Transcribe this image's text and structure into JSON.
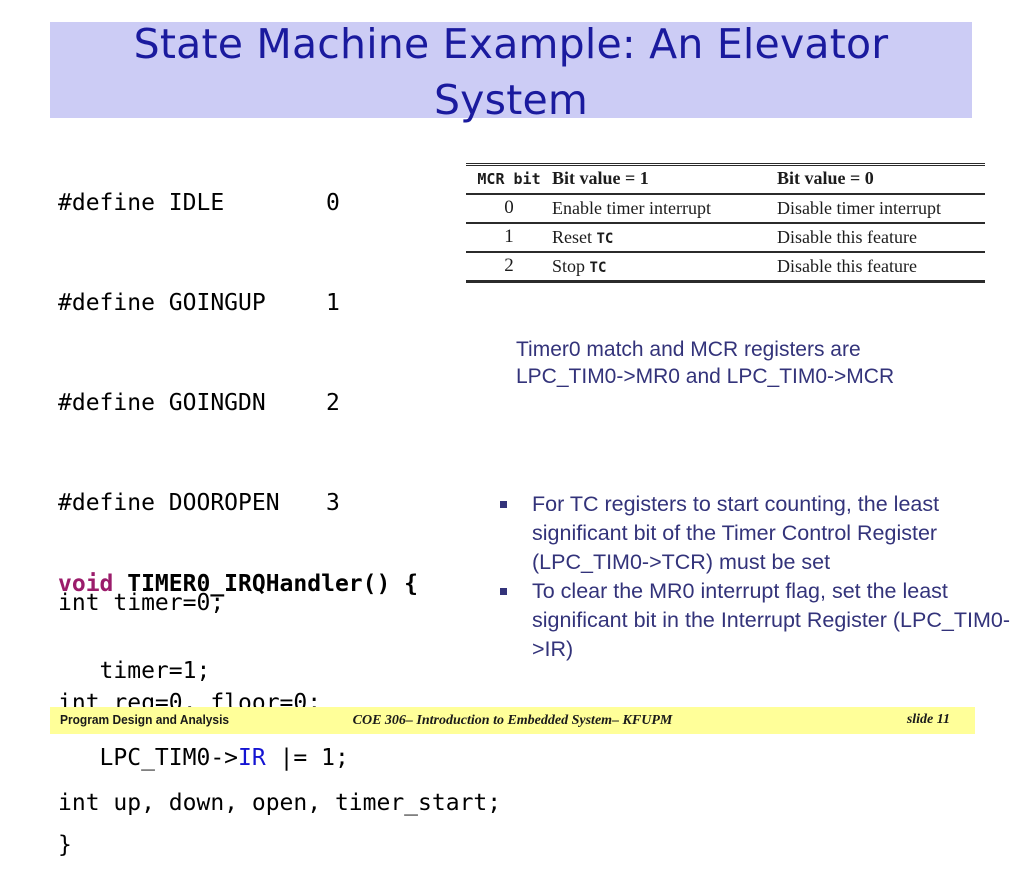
{
  "slide": {
    "title": "State Machine Example: An Elevator\nSystem",
    "title_band_color": "#ccccf5",
    "title_text_color": "#1a1a9e"
  },
  "code_defines": {
    "lines": [
      {
        "directive": "#define IDLE",
        "value": "0"
      },
      {
        "directive": "#define GOINGUP",
        "value": "1"
      },
      {
        "directive": "#define GOINGDN",
        "value": "2"
      },
      {
        "directive": "#define DOOROPEN",
        "value": "3"
      }
    ],
    "declarations": [
      "int timer=0;",
      "int req=0, floor=0;",
      "int up, down, open, timer_start;"
    ]
  },
  "code_handler": {
    "keyword": "void",
    "keyword_color": "#9b1c6b",
    "signature": " TIMER0_IRQHandler() {",
    "body_line1": "   timer=1;",
    "body_line2_pre": "   LPC_TIM0->",
    "body_line2_reg": "IR",
    "body_line2_reg_color": "#1414d2",
    "body_line2_post": " |= 1;",
    "close_brace": "}"
  },
  "mcr_table": {
    "headers": [
      "MCR bit",
      "Bit value = 1",
      "Bit value = 0"
    ],
    "rows": [
      [
        "0",
        "Enable timer interrupt",
        "Disable timer interrupt"
      ],
      [
        "1",
        "Reset TC",
        "Disable this feature"
      ],
      [
        "2",
        "Stop TC",
        "Disable this feature"
      ]
    ],
    "row1_value1_text": "Reset ",
    "row1_value1_mono": "TC",
    "row2_value1_text": "Stop ",
    "row2_value1_mono": "TC"
  },
  "table_note": "Timer0 match and MCR registers are\nLPC_TIM0->MR0 and LPC_TIM0->MCR",
  "bullets": [
    "For TC registers to start counting, the least  significant bit of the Timer Control Register (LPC_TIM0->TCR) must be set",
    "To clear the MR0 interrupt flag, set the least significant bit in the Interrupt Register (LPC_TIM0->IR)"
  ],
  "footer": {
    "left": "Program Design and Analysis",
    "center": "COE 306– Introduction to Embedded System– KFUPM",
    "right": "slide 11",
    "bar_color": "#ffff99"
  }
}
